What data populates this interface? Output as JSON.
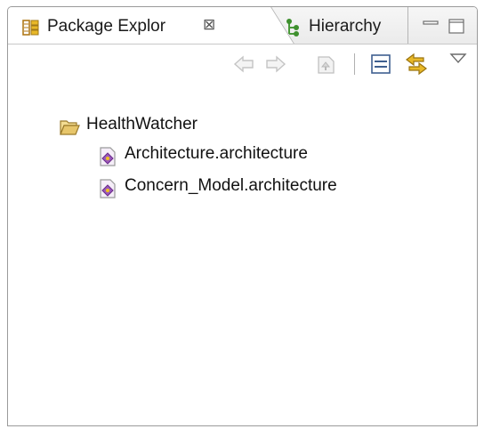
{
  "tabs": {
    "active": {
      "label": "Package Explor",
      "close_symbol": "⊠",
      "icon": "package-explorer-icon"
    },
    "inactive": {
      "label": "Hierarchy",
      "icon": "hierarchy-icon"
    }
  },
  "window_controls": [
    "minimize-icon",
    "maximize-icon"
  ],
  "toolbar": {
    "buttons": [
      "back-icon",
      "forward-icon",
      "up-icon",
      "collapse-all-icon",
      "link-with-editor-icon",
      "view-menu-icon"
    ]
  },
  "tree": {
    "project": {
      "label": "HealthWatcher",
      "icon": "open-folder-icon"
    },
    "files": [
      {
        "label": "Architecture.architecture",
        "icon": "architecture-file-icon"
      },
      {
        "label": "Concern_Model.architecture",
        "icon": "architecture-file-icon"
      }
    ]
  },
  "colors": {
    "accent_yellow": "#e8b828",
    "accent_green": "#4a9a3a",
    "folder": "#e7c66b",
    "file_purple": "#9a5ab8"
  }
}
